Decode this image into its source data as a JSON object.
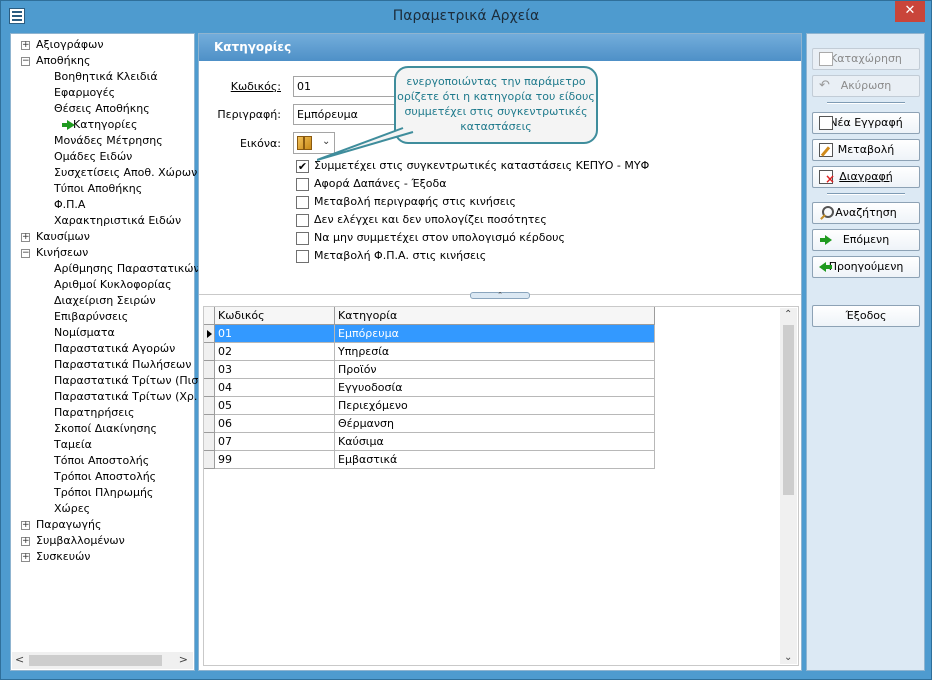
{
  "window": {
    "title": "Παραμετρικά Αρχεία",
    "close_glyph": "✕"
  },
  "tree": {
    "groups": [
      {
        "label": "Αξιογράφων",
        "expanded": false,
        "toggle": "+"
      },
      {
        "label": "Αποθήκης",
        "expanded": true,
        "toggle": "−"
      },
      {
        "label": "Καυσίμων",
        "expanded": false,
        "toggle": "+"
      },
      {
        "label": "Κινήσεων",
        "expanded": true,
        "toggle": "−"
      },
      {
        "label": "Παραγωγής",
        "expanded": false,
        "toggle": "+"
      },
      {
        "label": "Συμβαλλομένων",
        "expanded": false,
        "toggle": "+"
      },
      {
        "label": "Συσκευών",
        "expanded": false,
        "toggle": "+"
      }
    ],
    "apothikis_items": [
      "Βοηθητικά Κλειδιά",
      "Εφαρμογές",
      "Θέσεις Αποθήκης",
      "Κατηγορίες",
      "Μονάδες Μέτρησης",
      "Ομάδες Ειδών",
      "Συσχετίσεις Αποθ. Χώρων",
      "Τύποι Αποθήκης",
      "Φ.Π.Α",
      "Χαρακτηριστικά Ειδών"
    ],
    "kiniseon_items": [
      "Αρίθμησης Παραστατικών",
      "Αριθμοί Κυκλοφορίας",
      "Διαχείριση Σειρών",
      "Επιβαρύνσεις",
      "Νομίσματα",
      "Παραστατικά Αγορών",
      "Παραστατικά Πωλήσεων",
      "Παραστατικά Τρίτων (Πιστ.)",
      "Παραστατικά Τρίτων (Χρ.)",
      "Παρατηρήσεις",
      "Σκοποί Διακίνησης",
      "Ταμεία",
      "Τόποι Αποστολής",
      "Τρόποι Αποστολής",
      "Τρόποι Πληρωμής",
      "Χώρες"
    ],
    "selected": "Κατηγορίες",
    "scroll_left": "<",
    "scroll_right": ">"
  },
  "main": {
    "section_title": "Κατηγορίες",
    "form": {
      "code_label": "Κωδικός:",
      "code_value": "01",
      "desc_label": "Περιγραφή:",
      "desc_value": "Εμπόρευμα",
      "image_label": "Εικόνα:",
      "image_dropdown_glyph": "⌄"
    },
    "tooltip": "ενεργοποιώντας την παράμετρο ορίζετε ότι η κατηγορία του είδους συμμετέχει στις συγκεντρωτικές καταστάσεις",
    "checkboxes": [
      {
        "label": "Συμμετέχει στις συγκεντρωτικές καταστάσεις ΚΕΠΥΟ - ΜΥΦ",
        "checked": true,
        "mark": "✔"
      },
      {
        "label": "Αφορά Δαπάνες - Έξοδα",
        "checked": false,
        "mark": ""
      },
      {
        "label": "Μεταβολή περιγραφής στις κινήσεις",
        "checked": false,
        "mark": ""
      },
      {
        "label": "Δεν ελέγχει και δεν υπολογίζει ποσότητες",
        "checked": false,
        "mark": ""
      },
      {
        "label": "Να μην συμμετέχει στον υπολογισμό κέρδους",
        "checked": false,
        "mark": ""
      },
      {
        "label": "Μεταβολή Φ.Π.Α. στις κινήσεις",
        "checked": false,
        "mark": ""
      }
    ],
    "splitter_glyph": "⌃",
    "grid": {
      "columns": [
        "Κωδικός",
        "Κατηγορία"
      ],
      "rows": [
        {
          "code": "01",
          "category": "Εμπόρευμα",
          "selected": true
        },
        {
          "code": "02",
          "category": "Υπηρεσία",
          "selected": false
        },
        {
          "code": "03",
          "category": "Προϊόν",
          "selected": false
        },
        {
          "code": "04",
          "category": "Εγγυοδοσία",
          "selected": false
        },
        {
          "code": "05",
          "category": "Περιεχόμενο",
          "selected": false
        },
        {
          "code": "06",
          "category": "Θέρμανση",
          "selected": false
        },
        {
          "code": "07",
          "category": "Καύσιμα",
          "selected": false
        },
        {
          "code": "99",
          "category": "Εμβαστικά",
          "selected": false
        }
      ],
      "scroll_up": "⌃",
      "scroll_down": "⌄"
    }
  },
  "toolbar": {
    "save": "Καταχώρηση",
    "cancel": "Ακύρωση",
    "new": "Νέα Εγγραφή",
    "edit": "Μεταβολή",
    "delete": "Διαγραφή",
    "search": "Αναζήτηση",
    "next": "Επόμενη",
    "prev": "Προηγούμενη",
    "exit": "Έξοδος"
  },
  "colors": {
    "accent": "#4e9bcf",
    "selection": "#3399ff",
    "tooltip_border": "#3f8d9c",
    "close_button": "#c9453a"
  }
}
